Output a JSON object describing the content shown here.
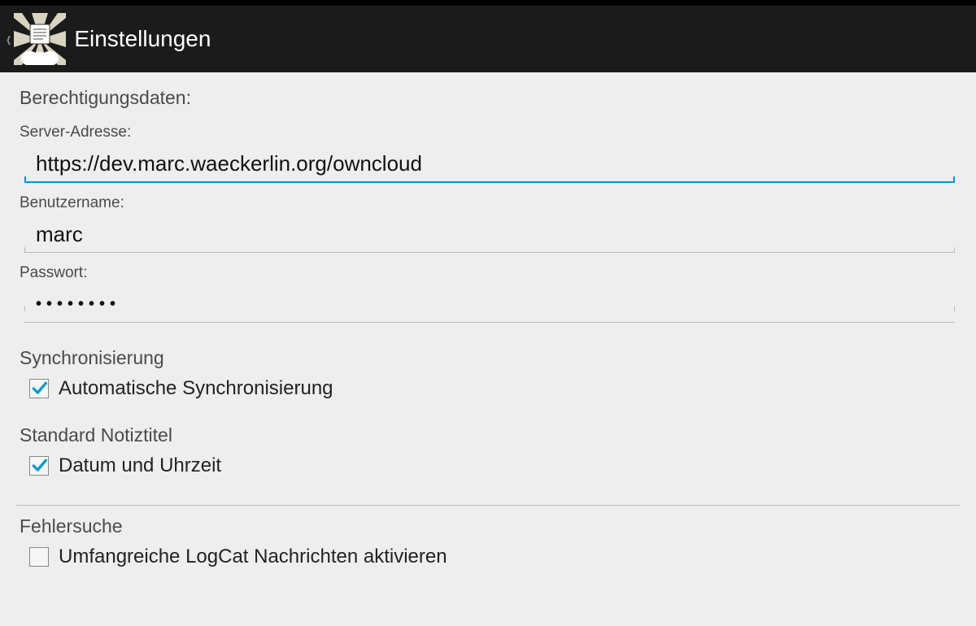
{
  "header": {
    "title": "Einstellungen"
  },
  "credentials": {
    "section_title": "Berechtigungsdaten:",
    "server_label": "Server-Adresse:",
    "server_value": "https://dev.marc.waeckerlin.org/owncloud",
    "username_label": "Benutzername:",
    "username_value": "marc",
    "password_label": "Passwort:",
    "password_value": "••••••••"
  },
  "sync": {
    "heading": "Synchronisierung",
    "auto_sync_label": "Automatische Synchronisierung",
    "auto_sync_checked": true
  },
  "note_title": {
    "heading": "Standard Notiztitel",
    "datetime_label": "Datum und Uhrzeit",
    "datetime_checked": true
  },
  "debug": {
    "heading": "Fehlersuche",
    "logcat_label": "Umfangreiche LogCat Nachrichten aktivieren",
    "logcat_checked": false
  }
}
